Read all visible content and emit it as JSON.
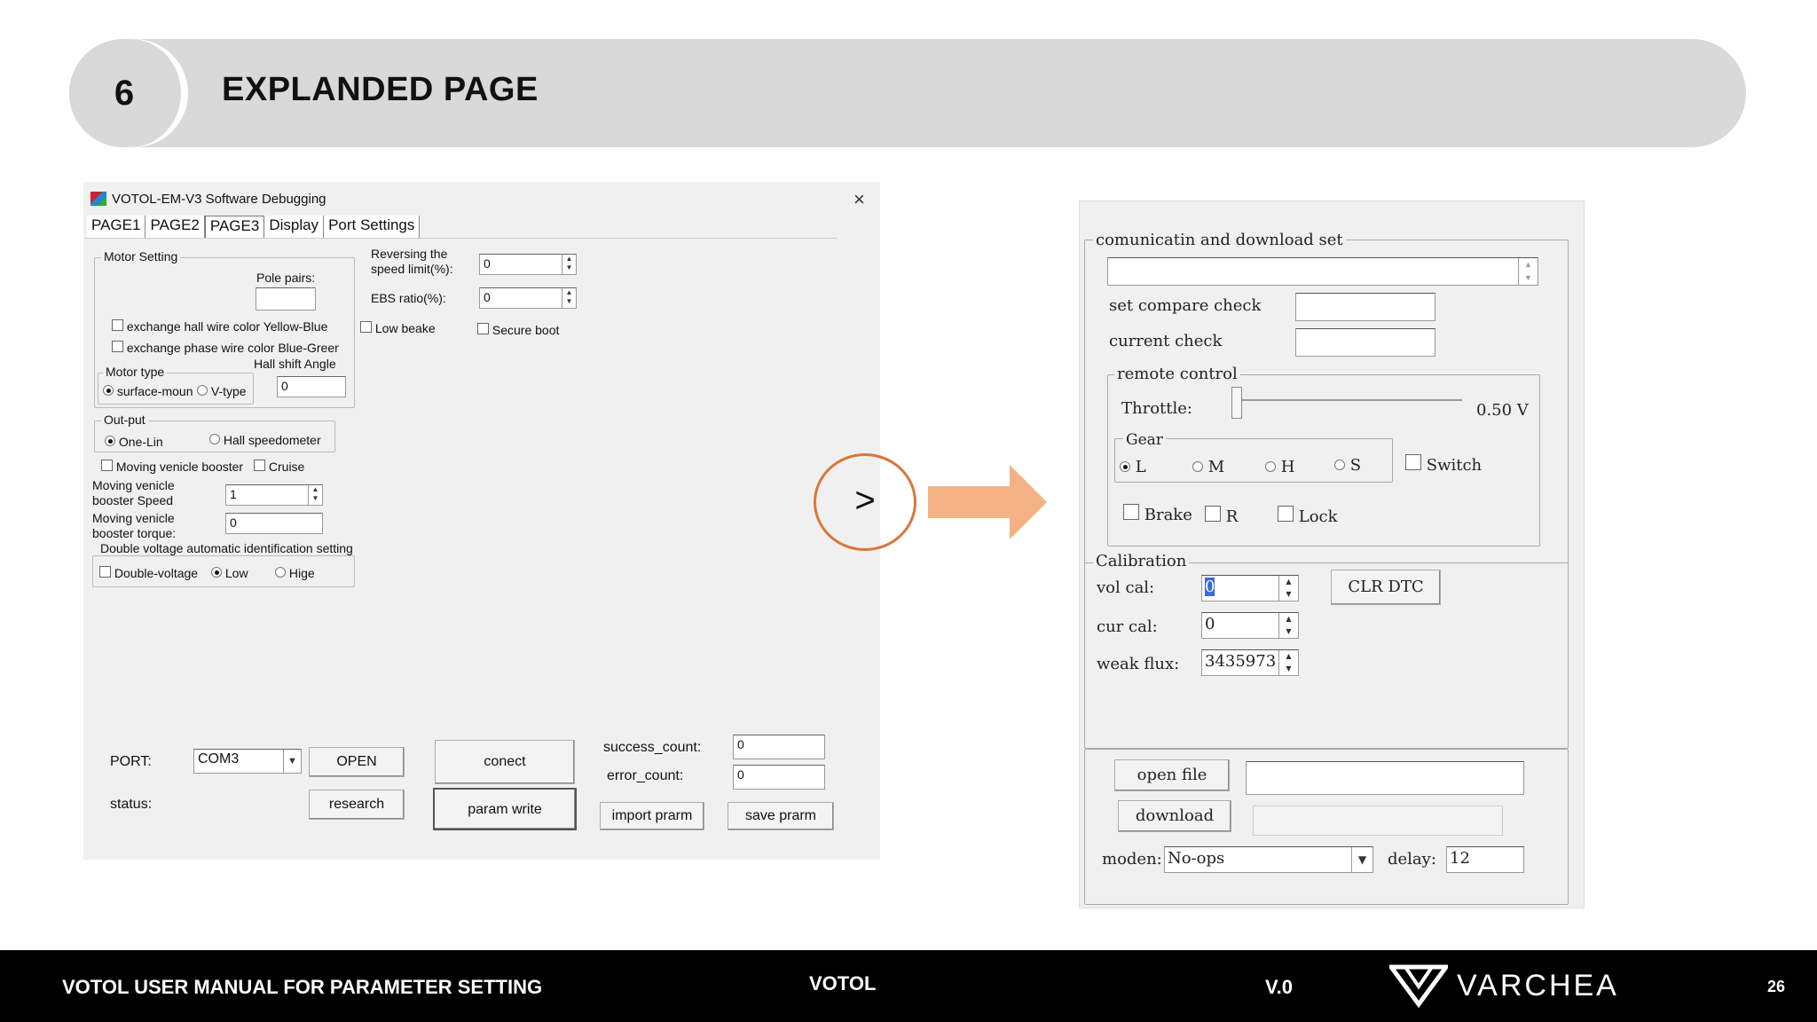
{
  "header": {
    "number": "6",
    "title": "EXPLANDED PAGE"
  },
  "left_window": {
    "title": "VOTOL-EM-V3 Software Debugging",
    "close": "×",
    "tabs": [
      "PAGE1",
      "PAGE2",
      "PAGE3",
      "Display",
      "Port Settings"
    ],
    "motor_setting": {
      "label": "Motor Setting",
      "pole_pairs_label": "Pole pairs:",
      "pole_pairs_value": "",
      "exchange_hall": "exchange hall wire color Yellow-Blue",
      "exchange_phase": "exchange phase wire color Blue-Green",
      "hall_shift_label": "Hall shift Angle",
      "hall_shift_value": "0",
      "motor_type_label": "Motor type",
      "surface_mount": "surface-moun",
      "v_type": "V-type"
    },
    "reversing_label_1": "Reversing the",
    "reversing_label_2": "speed limit(%):",
    "reversing_value": "0",
    "ebs_label": "EBS ratio(%):",
    "ebs_value": "0",
    "low_beake": "Low beake",
    "secure_boot": "Secure boot",
    "output": {
      "label": "Out-put",
      "one_lin": "One-Lin",
      "hall_speedometer": "Hall speedometer"
    },
    "moving_booster": "Moving venicle booster",
    "cruise": "Cruise",
    "booster_speed_1": "Moving venicle",
    "booster_speed_2": "booster Speed",
    "booster_speed_value": "1",
    "booster_torque_1": "Moving venicle",
    "booster_torque_2": "booster torque:",
    "booster_torque_value": "0",
    "double_voltage": {
      "label": "Double voltage automatic identification setting",
      "double": "Double-voltage",
      "low": "Low",
      "high": "Hige"
    },
    "port_label": "PORT:",
    "port_value": "COM3",
    "open": "OPEN",
    "status_label": "status:",
    "research": "research",
    "conect": "conect",
    "param_write": "param write",
    "success_label": "success_count:",
    "success_value": "0",
    "error_label": "error_count:",
    "error_value": "0",
    "import": "import prarm",
    "save": "save prarm"
  },
  "arrow_symbol": ">",
  "right_window": {
    "comm_label": "comunicatin and download set",
    "set_compare": "set compare check",
    "current_check": "current check",
    "remote_label": "remote control",
    "throttle_label": "Throttle:",
    "throttle_value": "0.50 V",
    "throttle_level": 0.0,
    "gear_label": "Gear",
    "gears": [
      "L",
      "M",
      "H",
      "S"
    ],
    "switch": "Switch",
    "brake": "Brake",
    "r": "R",
    "lock": "Lock",
    "calibration_label": "Calibration",
    "vol_cal_label": "vol cal:",
    "vol_cal_value": "0",
    "cur_cal_label": "cur cal:",
    "cur_cal_value": "0",
    "weak_flux_label": "weak flux:",
    "weak_flux_value": "3435973",
    "clr_dtc": "CLR DTC",
    "open_file": "open file",
    "download": "download",
    "moden_label": "moden:",
    "moden_value": "No-ops",
    "delay_label": "delay:",
    "delay_value": "12"
  },
  "footer": {
    "left": "VOTOL USER MANUAL FOR PARAMETER SETTING",
    "center": "VOTOL",
    "version": "V.0",
    "brand": "VARCHEA",
    "page": "26"
  },
  "colors": {
    "accent_orange": "#d9773a",
    "arrow_fill": "#f4b183",
    "header_band": "#d9d9d9",
    "footer": "#000000"
  }
}
